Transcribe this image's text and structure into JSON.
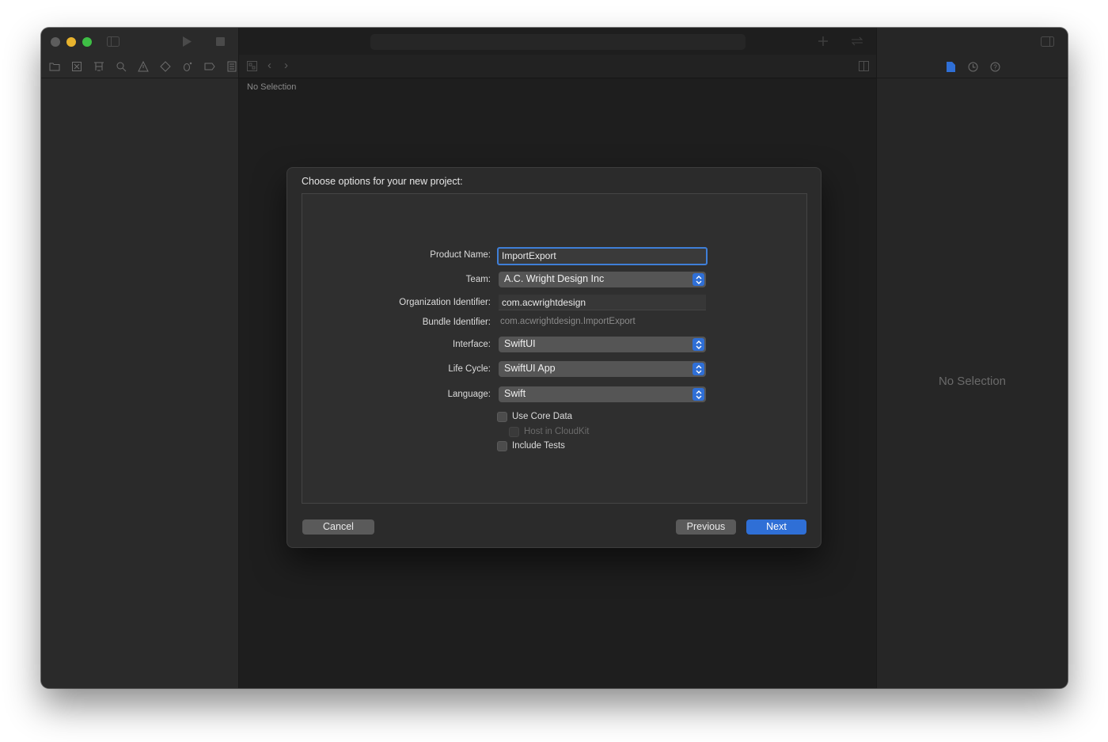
{
  "editor": {
    "no_selection": "No Selection"
  },
  "inspector": {
    "no_selection": "No Selection"
  },
  "dialog": {
    "title": "Choose options for your new project:",
    "product_name_label": "Product Name:",
    "product_name_value": "ImportExport",
    "team_label": "Team:",
    "team_value": "A.C. Wright Design Inc",
    "org_id_label": "Organization Identifier:",
    "org_id_value": "com.acwrightdesign",
    "bundle_id_label": "Bundle Identifier:",
    "bundle_id_value": "com.acwrightdesign.ImportExport",
    "interface_label": "Interface:",
    "interface_value": "SwiftUI",
    "lifecycle_label": "Life Cycle:",
    "lifecycle_value": "SwiftUI App",
    "language_label": "Language:",
    "language_value": "Swift",
    "use_core_data": "Use Core Data",
    "host_in_cloudkit": "Host in CloudKit",
    "include_tests": "Include Tests",
    "cancel": "Cancel",
    "previous": "Previous",
    "next": "Next"
  },
  "colors": {
    "accent": "#2f6fd6",
    "window_bg": "#1f1f1f",
    "sheet_bg": "#2b2b2b"
  },
  "icons": {
    "navigator": [
      "folder-icon",
      "source-control-icon",
      "symbol-icon",
      "search-icon",
      "warning-icon",
      "test-icon",
      "debug-icon",
      "breakpoint-icon",
      "report-icon"
    ],
    "inspector": [
      "file-icon",
      "history-icon",
      "help-icon"
    ]
  }
}
